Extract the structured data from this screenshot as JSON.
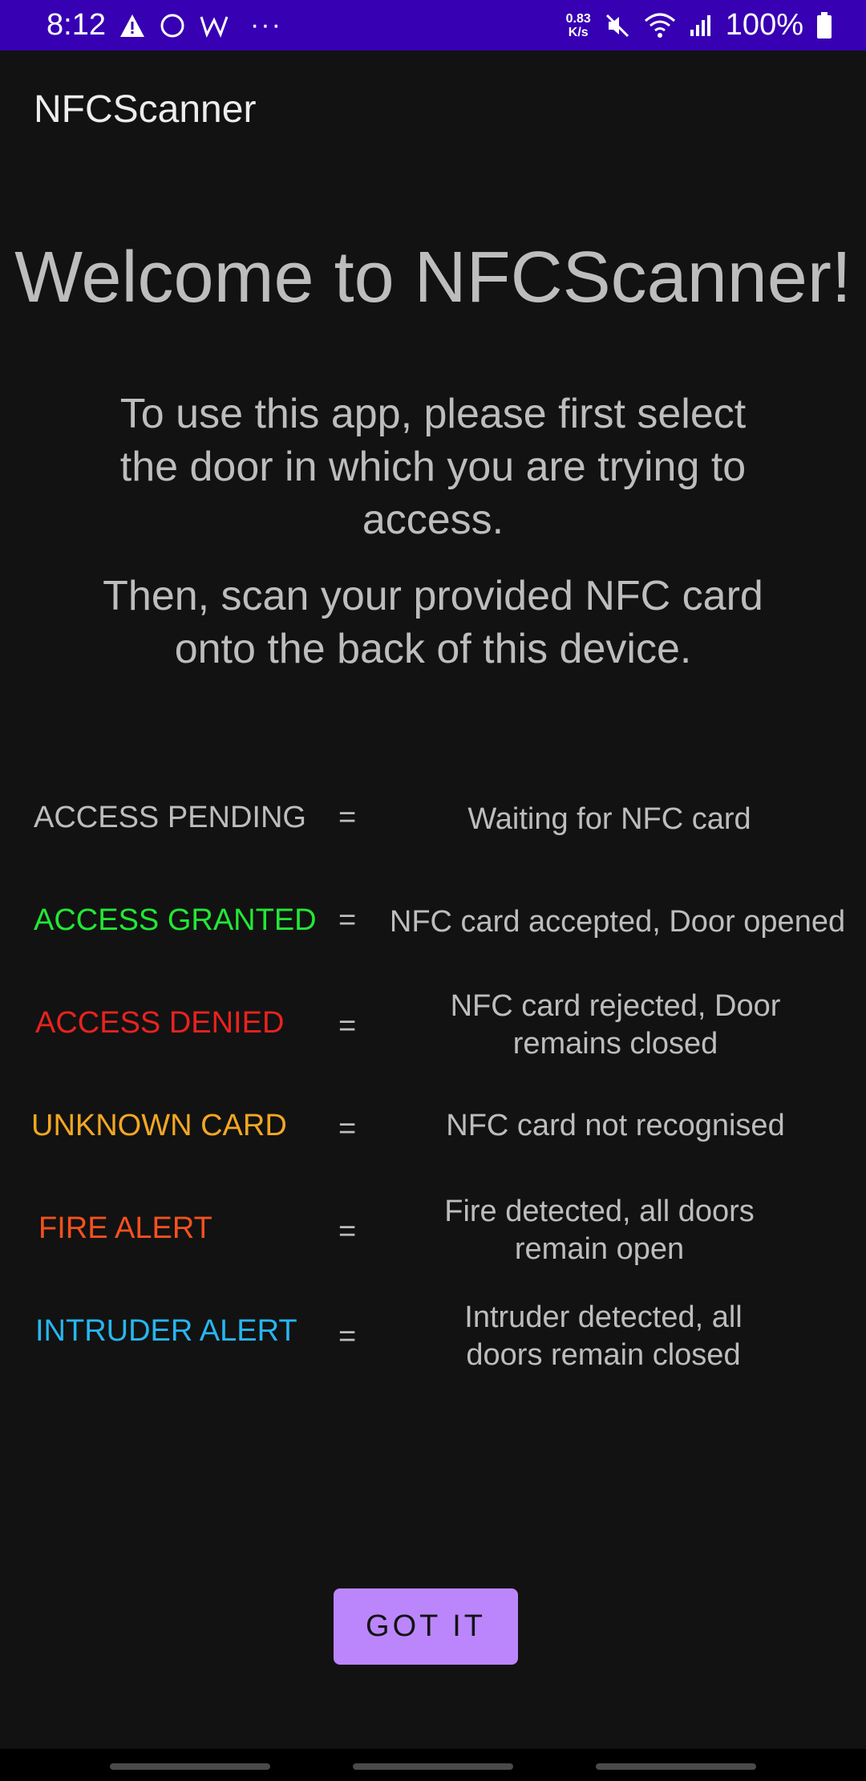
{
  "status_bar": {
    "time": "8:12",
    "speed_value": "0.83",
    "speed_unit": "K/s",
    "battery_percent": "100%",
    "dots": "···",
    "icons": [
      "warning-icon",
      "circle-sync-icon",
      "w-app-icon",
      "mute-icon",
      "wifi-icon",
      "signal-icon",
      "battery-icon"
    ]
  },
  "app_bar": {
    "title": "NFCScanner"
  },
  "main": {
    "welcome": "Welcome to NFCScanner!",
    "instruction_1": "To use this app, please first select the door in which you are trying to access.",
    "instruction_2": "Then, scan your provided NFC card onto the back of this device."
  },
  "legend": [
    {
      "status": "ACCESS PENDING",
      "eq": "=",
      "description": "Waiting for NFC card",
      "color": "#bdbdbd"
    },
    {
      "status": "ACCESS GRANTED",
      "eq": "=",
      "description": "NFC card accepted, Door opened",
      "color": "#22e834"
    },
    {
      "status": "ACCESS DENIED",
      "eq": "=",
      "description": "NFC card rejected, Door remains closed",
      "color": "#e8231e"
    },
    {
      "status": "UNKNOWN CARD",
      "eq": "=",
      "description": "NFC card not recognised",
      "color": "#f3a722"
    },
    {
      "status": "FIRE ALERT",
      "eq": "=",
      "description": "Fire detected, all doors remain open",
      "color": "#f4511e"
    },
    {
      "status": "INTRUDER ALERT",
      "eq": "=",
      "description": "Intruder detected, all doors remain closed",
      "color": "#27b6f0"
    }
  ],
  "button": {
    "label": "GOT IT"
  },
  "colors": {
    "status_bar": "#3700b3",
    "background": "#121212",
    "button": "#bb86fc"
  }
}
